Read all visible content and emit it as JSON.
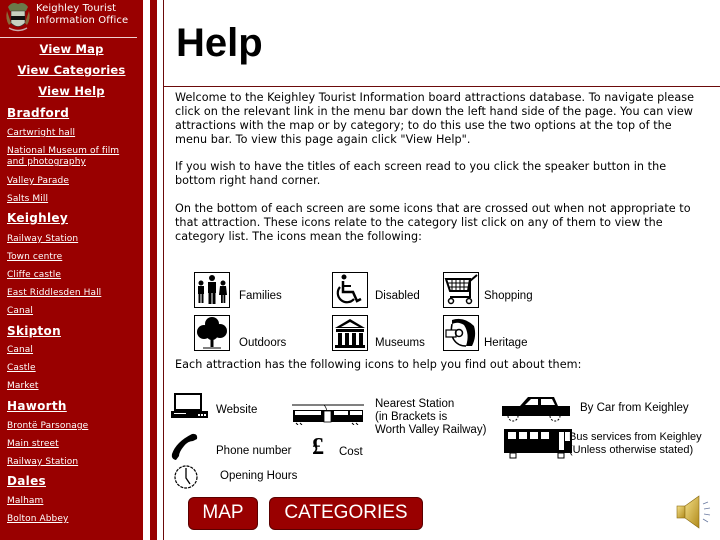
{
  "sidebar": {
    "office_name_line1": "Keighley Tourist",
    "office_name_line2": "Information Office",
    "nav": {
      "view_map": "View Map",
      "view_categories": "View Categories",
      "view_help": "View Help"
    },
    "groups": [
      {
        "title": "Bradford",
        "items": [
          "Cartwright hall",
          "National Museum of film and photography",
          "Valley Parade",
          "Salts Mill"
        ]
      },
      {
        "title": "Keighley",
        "items": [
          "Railway Station",
          "Town centre",
          "Cliffe castle",
          "East Riddlesden Hall",
          "Canal"
        ]
      },
      {
        "title": "Skipton",
        "items": [
          "Canal",
          "Castle",
          "Market"
        ]
      },
      {
        "title": "Haworth",
        "items": [
          "Brontë Parsonage",
          "Main street",
          "Railway Station"
        ]
      },
      {
        "title": "Dales",
        "items": [
          "Malham",
          "Bolton Abbey"
        ]
      }
    ]
  },
  "main": {
    "title": "Help",
    "paragraphs": [
      "Welcome to the Keighley Tourist Information board attractions database.  To navigate please click on the relevant link in the menu bar down the left hand side of the page.  You can view attractions with the map or by category; to do this use the two options at the top of the menu bar.  To view this page again click \"View Help\".",
      "If you wish to have the titles of each screen read to you click the speaker button in the bottom right hand corner.",
      "On the bottom of each screen are some icons that are crossed out when not appropriate to that attraction.  These icons relate to the category list click on any of them to view the category list.  The icons mean the following:",
      "Each attraction has the following icons to help you find out about them:"
    ],
    "category_icons": [
      {
        "icon": "families-icon",
        "label": "Families"
      },
      {
        "icon": "wheelchair-icon",
        "label": "Disabled"
      },
      {
        "icon": "shopping-cart-icon",
        "label": "Shopping"
      },
      {
        "icon": "tree-icon",
        "label": "Outdoors"
      },
      {
        "icon": "museum-icon",
        "label": "Museums"
      },
      {
        "icon": "helmet-icon",
        "label": "Heritage"
      }
    ],
    "info_icons": {
      "website": {
        "icon": "computer-icon",
        "label": "Website"
      },
      "phone": {
        "icon": "telephone-icon",
        "label": "Phone number"
      },
      "hours": {
        "icon": "clock-icon",
        "label": "Opening Hours"
      },
      "cost": {
        "icon": "pound-icon",
        "symbol": "£",
        "label": "Cost"
      },
      "station": {
        "icon": "train-icon",
        "label_lines": [
          "Nearest Station",
          "(in Brackets is",
          "Worth Valley Railway)"
        ]
      },
      "car": {
        "icon": "car-icon",
        "label": "By Car from Keighley"
      },
      "bus": {
        "icon": "bus-icon",
        "label_lines": [
          "Bus services from Keighley",
          "(Unless otherwise stated)"
        ]
      }
    },
    "buttons": {
      "map": "MAP",
      "categories": "CATEGORIES"
    },
    "speaker": {
      "icon": "speaker-icon"
    }
  },
  "colors": {
    "brand_red": "#990000",
    "rule": "#6b0a0a"
  }
}
